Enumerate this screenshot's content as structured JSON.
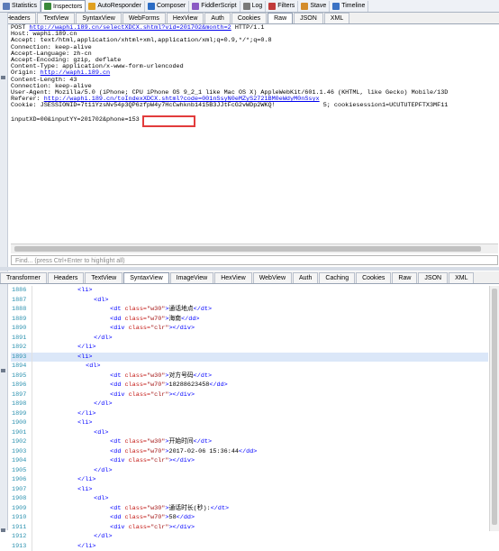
{
  "toolbar": [
    {
      "label": "Statistics",
      "icon": "statistics-icon",
      "color": "#5b7bb8"
    },
    {
      "label": "Inspectors",
      "icon": "inspectors-icon",
      "color": "#3a8a3a",
      "active": true
    },
    {
      "label": "AutoResponder",
      "icon": "lightning-icon",
      "color": "#e0a020"
    },
    {
      "label": "Composer",
      "icon": "composer-icon",
      "color": "#2b6cc4"
    },
    {
      "label": "FiddlerScript",
      "icon": "script-icon",
      "color": "#8a5ac4"
    },
    {
      "label": "Log",
      "icon": "log-icon",
      "color": "#7a7a7a"
    },
    {
      "label": "Filters",
      "icon": "filters-icon",
      "color": "#c03a3a"
    },
    {
      "label": "Stave",
      "icon": "stave-icon",
      "color": "#d48c2a"
    },
    {
      "label": "Timeline",
      "icon": "timeline-icon",
      "color": "#3a72c4"
    }
  ],
  "request_tabs": [
    "Headers",
    "TextView",
    "SyntaxView",
    "WebForms",
    "HexView",
    "Auth",
    "Cookies",
    "Raw",
    "JSON",
    "XML"
  ],
  "request_active": "Raw",
  "raw_lines": [
    {
      "pre": "POST ",
      "link": "http://waphi.189.cn/selectXDCX.shtml?vid=201702&month=2",
      "post": " HTTP/1.1"
    },
    {
      "pre": "Host: waphi.189.cn",
      "link": "",
      "post": ""
    },
    {
      "pre": "Accept: text/html,application/xhtml+xml,application/xml;q=0.9,*/*;q=0.8",
      "link": "",
      "post": ""
    },
    {
      "pre": "Connection: keep-alive",
      "link": "",
      "post": ""
    },
    {
      "pre": "Accept-Language: zh-cn",
      "link": "",
      "post": ""
    },
    {
      "pre": "Accept-Encoding: gzip, deflate",
      "link": "",
      "post": ""
    },
    {
      "pre": "Content-Type: application/x-www-form-urlencoded",
      "link": "",
      "post": ""
    },
    {
      "pre": "Origin: ",
      "link": "http://waphi.189.cn",
      "post": ""
    },
    {
      "pre": "Content-Length: 43",
      "link": "",
      "post": ""
    },
    {
      "pre": "Connection: keep-alive",
      "link": "",
      "post": ""
    },
    {
      "pre": "User-Agent: Mozilla/5.0 (iPhone; CPU iPhone OS 9_2_1 like Mac OS X) AppleWebKit/601.1.46 (KHTML, like Gecko) Mobile/13D",
      "link": "",
      "post": ""
    },
    {
      "pre": "Referer: ",
      "link": "http://waphi.189.cn/toIndexXDCX.shtml?code=001nSsyN0eMZyS2721BM0eWdyM0nSsyx",
      "post": ""
    },
    {
      "pre": "Cookie: JSESSIONID=7t11YzsNv54p3QP6zfpW4y7HcCwhknb1415B3JJtFcG2vWDp2WKQ!             5; cookiesession1=UCUTUTEPFTX3MF11",
      "link": "",
      "post": ""
    },
    {
      "pre": "",
      "link": "",
      "post": ""
    },
    {
      "pre": "inputXD=00&inputYY=201702&phone=153",
      "link": "",
      "post": ""
    }
  ],
  "find_placeholder": "Find... (press Ctrl+Enter to highlight all)",
  "response_tabs": [
    "Transformer",
    "Headers",
    "TextView",
    "SyntaxView",
    "ImageView",
    "HexView",
    "WebView",
    "Auth",
    "Caching",
    "Cookies",
    "Raw",
    "JSON",
    "XML"
  ],
  "response_active": "SyntaxView",
  "code_lines": [
    {
      "n": "1886",
      "indent": 5,
      "parts": [
        [
          "t",
          "<li>"
        ]
      ]
    },
    {
      "n": "1887",
      "indent": 7,
      "parts": [
        [
          "t",
          "<dl>"
        ]
      ]
    },
    {
      "n": "1888",
      "indent": 9,
      "parts": [
        [
          "t",
          "<dt "
        ],
        [
          "a",
          "class="
        ],
        [
          "v",
          "\"w30\""
        ],
        [
          "t",
          ">"
        ],
        [
          "x",
          "通话地点"
        ],
        [
          "t",
          "</dt>"
        ]
      ]
    },
    {
      "n": "1889",
      "indent": 9,
      "parts": [
        [
          "t",
          "<dd "
        ],
        [
          "a",
          "class="
        ],
        [
          "v",
          "\"w70\""
        ],
        [
          "t",
          ">"
        ],
        [
          "x",
          "海南"
        ],
        [
          "t",
          "</dd>"
        ]
      ]
    },
    {
      "n": "1890",
      "indent": 9,
      "parts": [
        [
          "t",
          "<div "
        ],
        [
          "a",
          "class="
        ],
        [
          "v",
          "\"clr\""
        ],
        [
          "t",
          "></div>"
        ]
      ]
    },
    {
      "n": "1891",
      "indent": 7,
      "parts": [
        [
          "t",
          "</dl>"
        ]
      ]
    },
    {
      "n": "1892",
      "indent": 5,
      "parts": [
        [
          "t",
          "</li>"
        ]
      ]
    },
    {
      "n": "1893",
      "indent": 5,
      "parts": [
        [
          "t",
          "<li>"
        ]
      ]
    },
    {
      "n": "1894",
      "indent": 6,
      "parts": [
        [
          "t",
          "<dl>"
        ]
      ]
    },
    {
      "n": "1895",
      "indent": 9,
      "parts": [
        [
          "t",
          "<dt "
        ],
        [
          "a",
          "class="
        ],
        [
          "v",
          "\"w30\""
        ],
        [
          "t",
          ">"
        ],
        [
          "x",
          "对方号码"
        ],
        [
          "t",
          "</dt>"
        ]
      ]
    },
    {
      "n": "1896",
      "indent": 9,
      "parts": [
        [
          "t",
          "<dd "
        ],
        [
          "a",
          "class="
        ],
        [
          "v",
          "\"w70\""
        ],
        [
          "t",
          ">"
        ],
        [
          "x",
          "18288623458"
        ],
        [
          "t",
          "</dd>"
        ]
      ]
    },
    {
      "n": "1897",
      "indent": 9,
      "parts": [
        [
          "t",
          "<div "
        ],
        [
          "a",
          "class="
        ],
        [
          "v",
          "\"clr\""
        ],
        [
          "t",
          "></div>"
        ]
      ]
    },
    {
      "n": "1898",
      "indent": 7,
      "parts": [
        [
          "t",
          "</dl>"
        ]
      ]
    },
    {
      "n": "1899",
      "indent": 5,
      "parts": [
        [
          "t",
          "</li>"
        ]
      ]
    },
    {
      "n": "1900",
      "indent": 5,
      "parts": [
        [
          "t",
          "<li>"
        ]
      ]
    },
    {
      "n": "1901",
      "indent": 7,
      "parts": [
        [
          "t",
          "<dl>"
        ]
      ]
    },
    {
      "n": "1902",
      "indent": 9,
      "parts": [
        [
          "t",
          "<dt "
        ],
        [
          "a",
          "class="
        ],
        [
          "v",
          "\"w30\""
        ],
        [
          "t",
          ">"
        ],
        [
          "x",
          "开始时间"
        ],
        [
          "t",
          "</dt>"
        ]
      ]
    },
    {
      "n": "1903",
      "indent": 9,
      "parts": [
        [
          "t",
          "<dd "
        ],
        [
          "a",
          "class="
        ],
        [
          "v",
          "\"w70\""
        ],
        [
          "t",
          ">"
        ],
        [
          "x",
          "2017-02-06 15:36:44"
        ],
        [
          "t",
          "</dd>"
        ]
      ]
    },
    {
      "n": "1904",
      "indent": 9,
      "parts": [
        [
          "t",
          "<div "
        ],
        [
          "a",
          "class="
        ],
        [
          "v",
          "\"clr\""
        ],
        [
          "t",
          "></div>"
        ]
      ]
    },
    {
      "n": "1905",
      "indent": 7,
      "parts": [
        [
          "t",
          "</dl>"
        ]
      ]
    },
    {
      "n": "1906",
      "indent": 5,
      "parts": [
        [
          "t",
          "</li>"
        ]
      ]
    },
    {
      "n": "1907",
      "indent": 5,
      "parts": [
        [
          "t",
          "<li>"
        ]
      ]
    },
    {
      "n": "1908",
      "indent": 7,
      "parts": [
        [
          "t",
          "<dl>"
        ]
      ]
    },
    {
      "n": "1909",
      "indent": 9,
      "parts": [
        [
          "t",
          "<dt "
        ],
        [
          "a",
          "class="
        ],
        [
          "v",
          "\"w30\""
        ],
        [
          "t",
          ">"
        ],
        [
          "x",
          "通话时长(秒):"
        ],
        [
          "t",
          "</dt>"
        ]
      ]
    },
    {
      "n": "1910",
      "indent": 9,
      "parts": [
        [
          "t",
          "<dd "
        ],
        [
          "a",
          "class="
        ],
        [
          "v",
          "\"w70\""
        ],
        [
          "t",
          ">"
        ],
        [
          "x",
          "58"
        ],
        [
          "t",
          "</dd>"
        ]
      ]
    },
    {
      "n": "1911",
      "indent": 9,
      "parts": [
        [
          "t",
          "<div "
        ],
        [
          "a",
          "class="
        ],
        [
          "v",
          "\"clr\""
        ],
        [
          "t",
          "></div>"
        ]
      ]
    },
    {
      "n": "1912",
      "indent": 7,
      "parts": [
        [
          "t",
          "</dl>"
        ]
      ]
    },
    {
      "n": "1913",
      "indent": 5,
      "parts": [
        [
          "t",
          "</li>"
        ]
      ]
    }
  ]
}
